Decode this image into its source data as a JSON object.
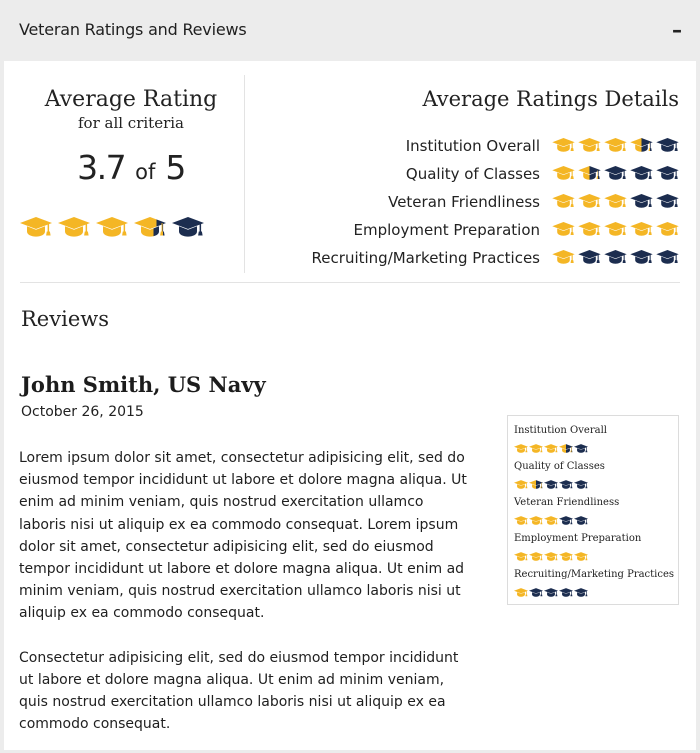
{
  "header": {
    "title": "Veteran Ratings and Reviews",
    "collapse_symbol": "–"
  },
  "summary": {
    "title": "Average Rating",
    "subtitle": "for all criteria",
    "score": "3.7",
    "of_text": "of",
    "max": "5",
    "rating_value": 3.7,
    "details_title": "Average Ratings Details",
    "criteria": [
      {
        "label": "Institution Overall",
        "rating": 3.5
      },
      {
        "label": "Quality of Classes",
        "rating": 1.5
      },
      {
        "label": "Veteran Friendliness",
        "rating": 3
      },
      {
        "label": "Employment Preparation",
        "rating": 5
      },
      {
        "label": "Recruiting/Marketing Practices",
        "rating": 1
      }
    ]
  },
  "reviews": {
    "title": "Reviews",
    "items": [
      {
        "author": "John Smith, US Navy",
        "date": "October 26, 2015",
        "paragraphs": [
          "Lorem ipsum dolor sit amet, consectetur adipisicing elit, sed do eiusmod tempor incididunt ut labore et dolore magna aliqua. Ut enim ad minim veniam, quis nostrud exercitation ullamco laboris nisi ut aliquip ex ea commodo consequat. Lorem ipsum dolor sit amet, consectetur adipisicing elit, sed do eiusmod tempor incididunt ut labore et dolore magna aliqua. Ut enim ad minim veniam, quis nostrud exercitation ullamco laboris nisi ut aliquip ex ea commodo consequat.",
          "Consectetur adipisicing elit, sed do eiusmod tempor incididunt ut labore et dolore magna aliqua. Ut enim ad minim veniam, quis nostrud exercitation ullamco laboris nisi ut aliquip ex ea commodo consequat."
        ],
        "ratings": [
          {
            "label": "Institution Overall",
            "rating": 3.5
          },
          {
            "label": "Quality of Classes",
            "rating": 1.5
          },
          {
            "label": "Veteran Friendliness",
            "rating": 3
          },
          {
            "label": "Employment Preparation",
            "rating": 5
          },
          {
            "label": "Recruiting/Marketing Practices",
            "rating": 1
          }
        ]
      }
    ]
  },
  "icons": {
    "rating_icon": "graduation-cap-icon"
  },
  "colors": {
    "filled": "#f4b625",
    "empty": "#1c2d4f",
    "header_bg": "#ececec",
    "divider": "#e3e3e3"
  }
}
